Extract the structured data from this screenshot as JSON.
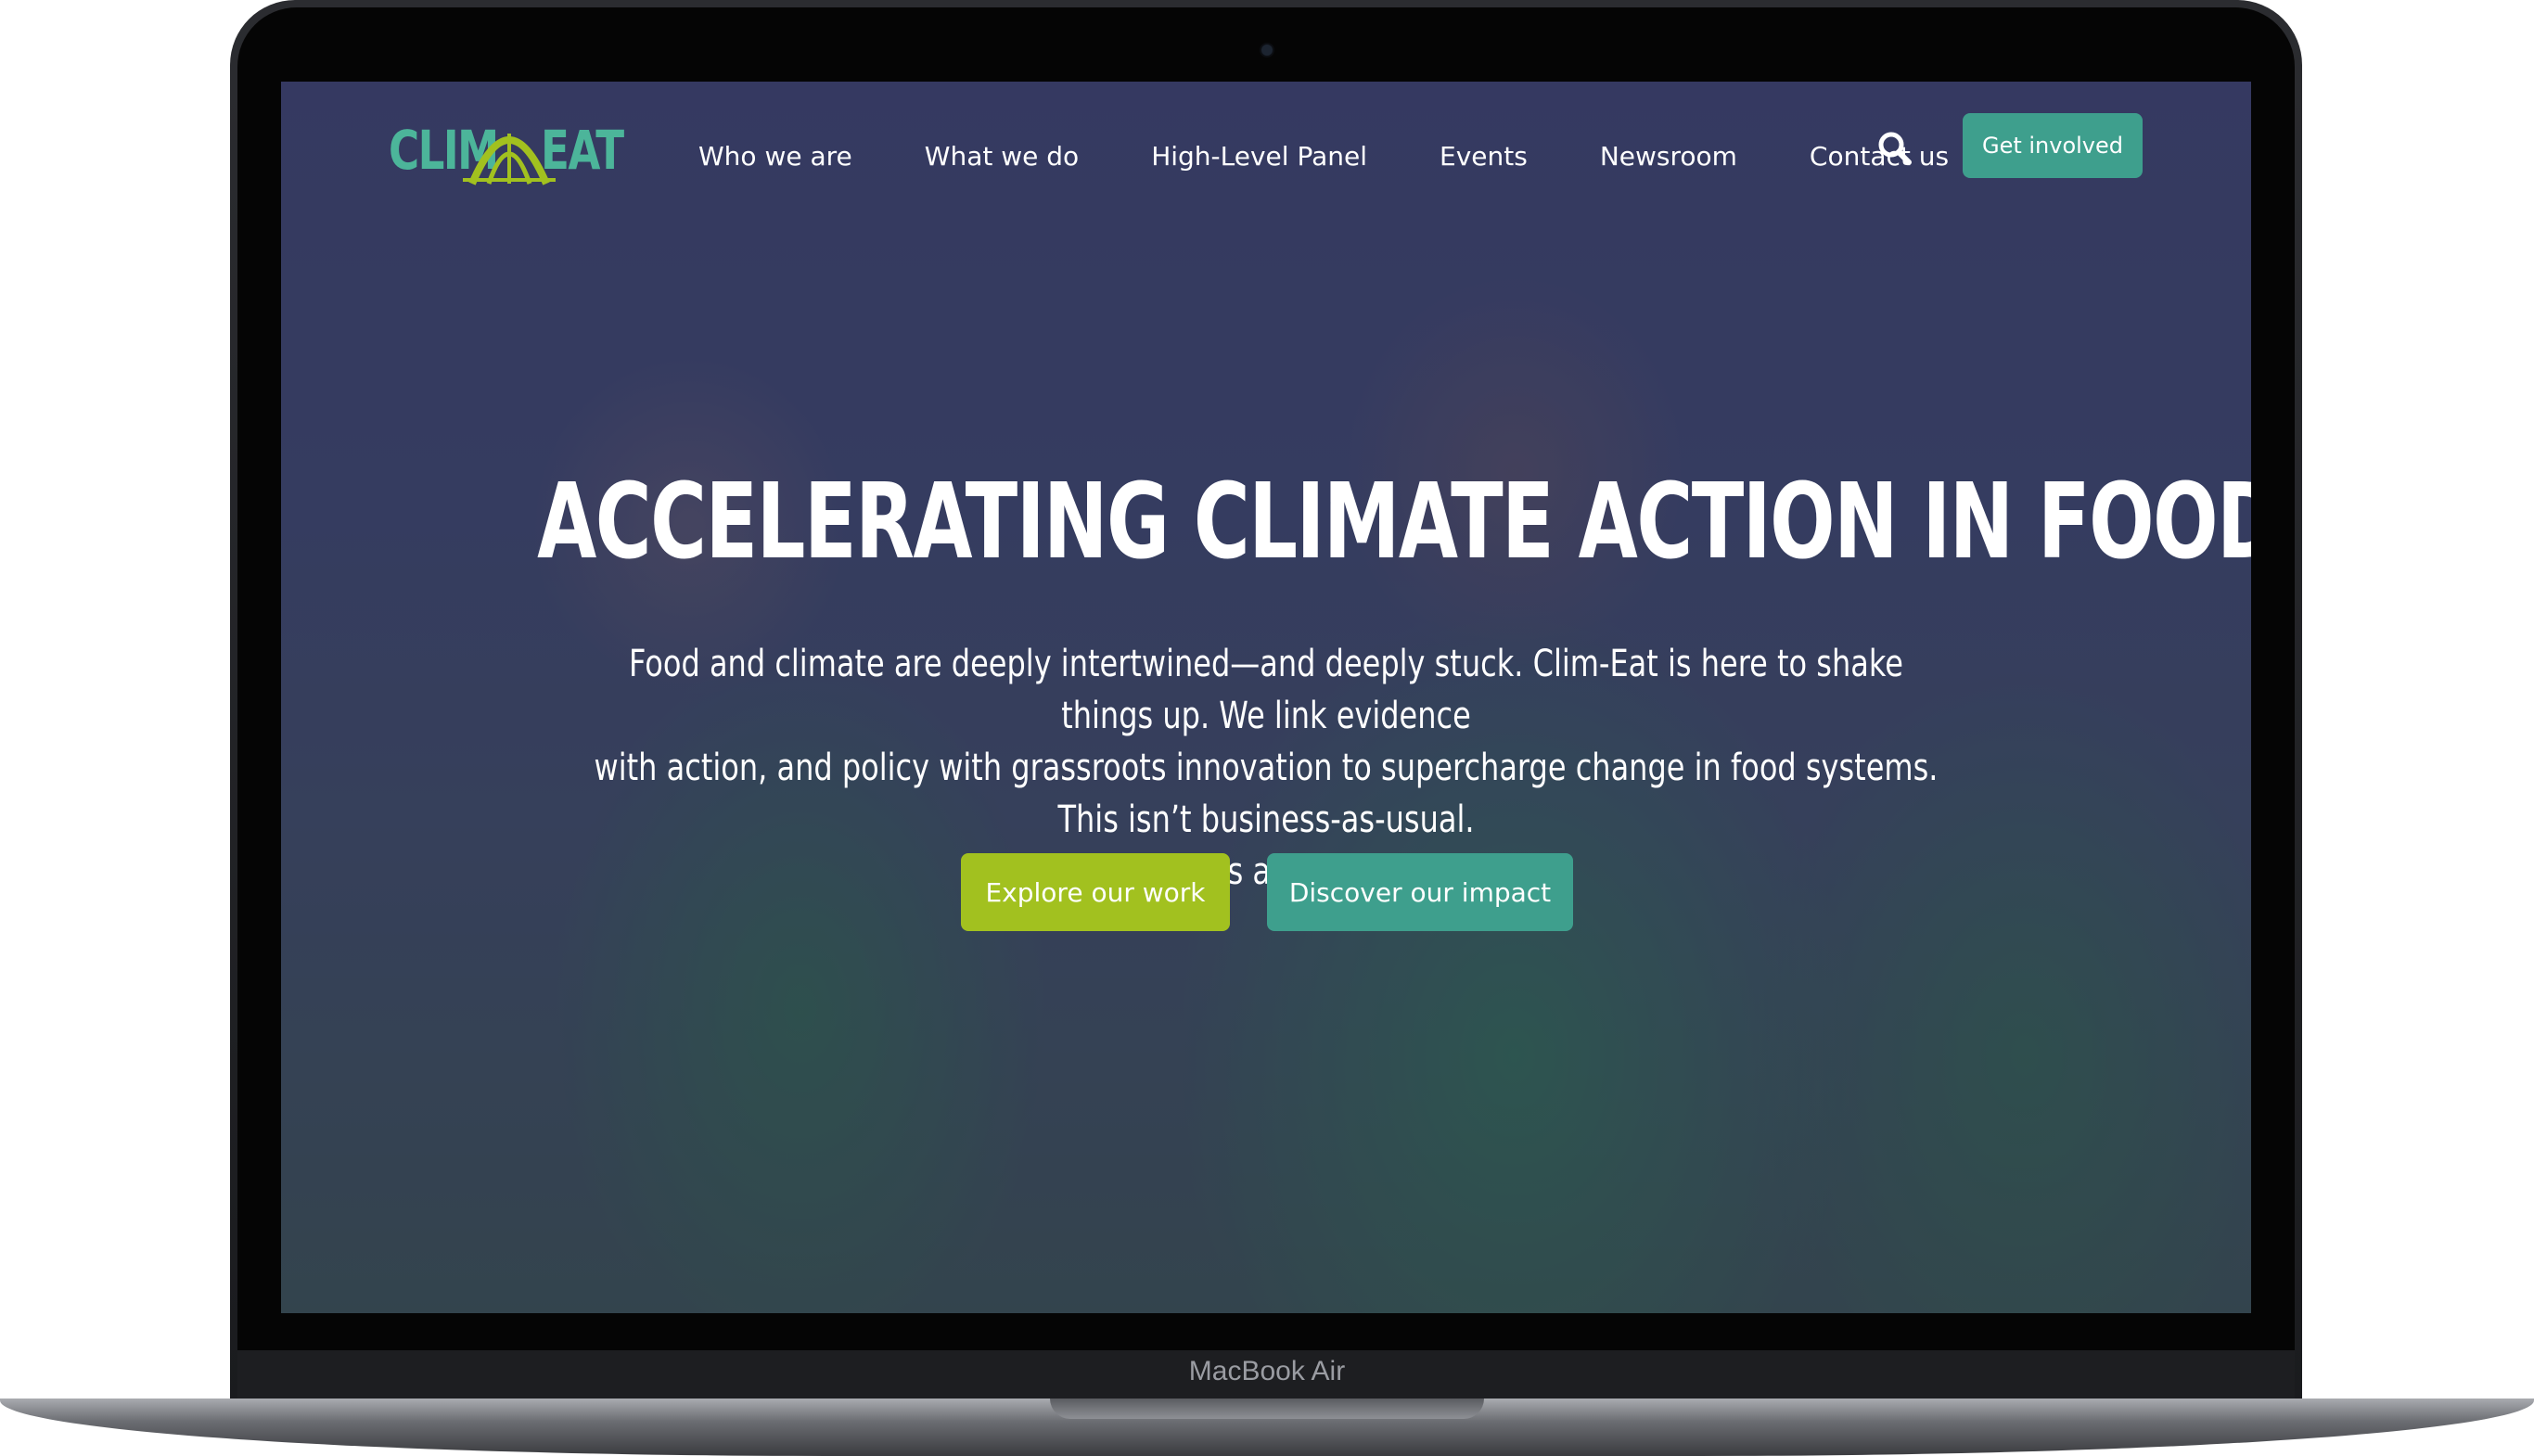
{
  "device": {
    "model_label": "MacBook Air"
  },
  "site": {
    "logo": {
      "left_text": "CLIM",
      "right_text": "EAT",
      "icon": "arch-logo-icon",
      "color_teal": "#4cb59a",
      "color_lime": "#a2c11f"
    },
    "nav": {
      "items": [
        {
          "label": "Who we are"
        },
        {
          "label": "What we do"
        },
        {
          "label": "High-Level Panel"
        },
        {
          "label": "Events"
        },
        {
          "label": "Newsroom"
        },
        {
          "label": "Contact us"
        }
      ],
      "search_icon": "search-icon",
      "cta_label": "Get involved"
    },
    "hero": {
      "title": "ACCELERATING CLIMATE ACTION IN FOOD SYSTEMS",
      "text_line1": "Food and climate are deeply intertwined—and deeply stuck. Clim-Eat is here to shake things up. We link evidence",
      "text_line2": "with action, and policy with grassroots innovation to supercharge change in food systems. This isn’t business-as-usual.",
      "text_line3": "It’s all-in.",
      "primary_button": "Explore our work",
      "secondary_button": "Discover our impact"
    },
    "colors": {
      "primary_teal": "#3e9f8d",
      "accent_lime": "#a2c11f"
    }
  }
}
